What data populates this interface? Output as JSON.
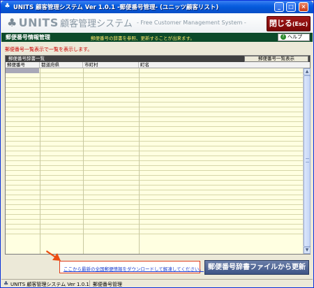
{
  "window": {
    "title": "UNITS 顧客管理システム  Ver 1.0.1 -郵便番号管理- (ユニッツ顧客リスト)",
    "controls": {
      "minimize": "_",
      "maximize": "□",
      "close": "×"
    }
  },
  "header": {
    "logo_mark": "♣",
    "logo_units": "UNITS",
    "logo_jp": "顧客管理システム",
    "logo_en": "- Free Customer Management System -",
    "close_label": "閉じる",
    "close_key": "(Esc)"
  },
  "section": {
    "title": "郵便番号情報管理",
    "description": "郵便番号の辞書を参照、更新することが出来ます。",
    "help_label": "ヘルプ",
    "help_icon": "?"
  },
  "status_message": "郵便番号一覧表示で一覧を表示します。",
  "list": {
    "title": "郵便番号辞書一覧",
    "show_button": "郵便番号一覧表示",
    "columns": [
      "郵便番号",
      "都道府県",
      "市町村",
      "町名"
    ],
    "rows": []
  },
  "download_link": "ここから最新の全国郵便情報をダウンロードして解凍してください。",
  "update_button": "郵便番号辞書ファイルから更新",
  "statusbar": {
    "icon": "♣",
    "app_version": "UNITS 顧客管理システム   Ver 1.0.1",
    "screen": "郵便番号管理"
  },
  "colors": {
    "section_bg": "#0c4a2a",
    "close_bg": "#8b0d0d",
    "grid_bg": "#ffffe1",
    "link_border": "#e03c1a"
  }
}
